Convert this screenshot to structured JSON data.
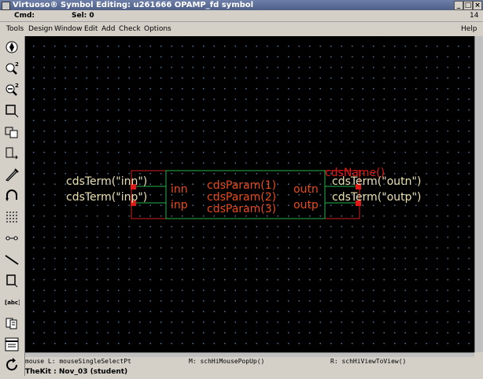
{
  "window": {
    "title": "Virtuoso® Symbol Editing: u261666 OPAMP_fd symbol",
    "minimize": "_",
    "maximize": "□",
    "close": "×"
  },
  "cmdbar": {
    "cmd_label": "Cmd:",
    "sel_label": "Sel: 0",
    "number": "14"
  },
  "menu": {
    "items": [
      "Tools",
      "Design",
      "Window",
      "Edit",
      "Add",
      "Check",
      "Options"
    ],
    "help": "Help"
  },
  "toolbar": {
    "tools": [
      "zoom-fit",
      "zoom-in",
      "zoom-out",
      "stretch",
      "copy",
      "move",
      "delete",
      "undo",
      "property",
      "pin",
      "wire",
      "rectangle",
      "label",
      "save",
      "redraw"
    ]
  },
  "symbol": {
    "terms_left": [
      "cdsTerm(\"inn\")",
      "cdsTerm(\"inp\")"
    ],
    "terms_right": [
      "cdsTerm(\"outn\")",
      "cdsTerm(\"outp\")"
    ],
    "pins_left": [
      "inn",
      "inp"
    ],
    "pins_right": [
      "outn",
      "outp"
    ],
    "params": [
      "cdsParam(1)",
      "cdsParam(2)",
      "cdsParam(3)"
    ],
    "instance_name": "cdsName()"
  },
  "status": {
    "left": "mouse L: mouseSingleSelectPt",
    "mid": "M: schHiMousePopUp()",
    "right": "R: schHiViewToView()"
  },
  "footer": {
    "kit": "TheKit : Nov_03  (student)"
  },
  "colors": {
    "canvas_bg": "#000000",
    "label_text": "#e8e0b0",
    "pin_text": "#e84a1c",
    "body_outline": "#23b24a",
    "selection_box": "#d42020"
  }
}
